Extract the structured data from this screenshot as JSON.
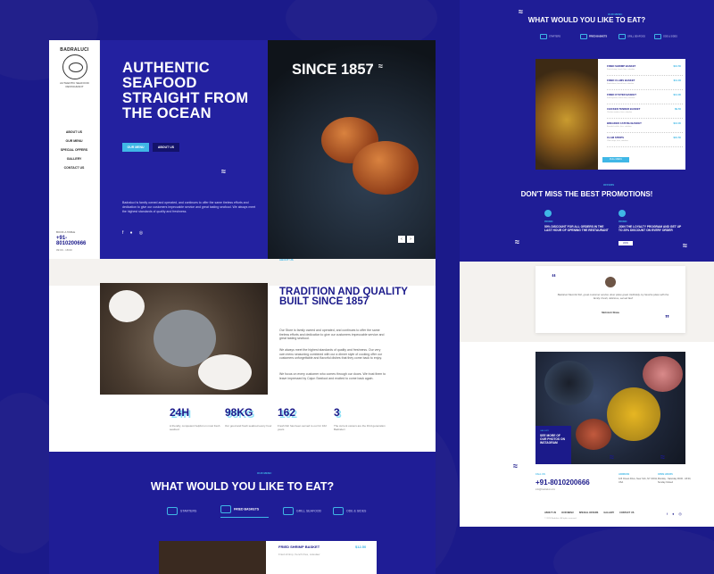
{
  "brand": {
    "name": "BADRALUCI",
    "tagline": "AUTHENTIC SEAFOOD RESTAURANT"
  },
  "nav": [
    "ABOUT US",
    "OUR MENU",
    "SPECIAL OFFERS",
    "GALLERY",
    "CONTACT US"
  ],
  "side_contact": {
    "label": "BOOK A TABLE",
    "phone": "+91-8010200666",
    "hours": "09:00 - 18:00"
  },
  "hero": {
    "title": "AUTHENTIC SEAFOOD STRAIGHT FROM THE OCEAN",
    "btn_primary": "OUR MENU",
    "btn_secondary": "ABOUT US",
    "description": "Badraluci is family owned and operated, and continues to offer the same tireless efforts and dedication to give our customers impeccable service and great tasting seafood. We always meet the highest standards of quality and freshness.",
    "social": "f ♦ ◎",
    "since": "SINCE 1857",
    "arrow_prev": "‹",
    "arrow_next": "›"
  },
  "about": {
    "small": "ABOUT US",
    "title": "TRADITION AND QUALITY BUILT SINCE 1857",
    "p1": "Our Store is family owned and operated, and continues to offer the same tireless efforts and dedication to give our customers impeccable service and great tasting seafood.",
    "p2": "We always meet the highest standards of quality and freshness. Our very own menu seasoning combined with our a dinner style of cooking offer our customers unforgettable and flavorful dishes that they come back to enjoy.",
    "p3": "We focus on every customer who comes through our doors. We trust them to leave impressed by Cajun Seafood and excited to come back again."
  },
  "stats": [
    {
      "num": "24H",
      "txt": "A friendly, competent helpful on most fresh seafood"
    },
    {
      "num": "98KG",
      "txt": "Our good and fresh seafood every hour"
    },
    {
      "num": "162",
      "txt": "Fresh fish has been served to our for 162 years"
    },
    {
      "num": "3",
      "txt": "The current owners are the third generation Badraluci"
    }
  ],
  "menu_left": {
    "small": "OUR MENU",
    "title": "WHAT WOULD YOU LIKE TO EAT?",
    "tabs": [
      "STARTERS",
      "FRIED BASKETS",
      "GRILL SEAFOOD",
      "ODE & SIDES"
    ],
    "item_name": "FRIED SHRIMP BASKET",
    "item_price": "$12.50",
    "item_desc": "Fried shrimp, french fries, coleslaw"
  },
  "right": {
    "small": "OUR MENU",
    "title": "WHAT WOULD YOU LIKE TO EAT?",
    "tabs": [
      "STARTERS",
      "FRIED BASKETS",
      "GRILL SEAFOOD",
      "ODE & SIDES"
    ],
    "items": [
      {
        "n": "FRIED SHRIMP BASKET",
        "p": "$12.50",
        "d": "Fried shrimp, french fries, coleslaw"
      },
      {
        "n": "FRIED CLAMS BASKET",
        "p": "$11.00",
        "d": "Fried clams, french fries, coleslaw"
      },
      {
        "n": "FRIED OYSTER BASKET",
        "p": "$14.00",
        "d": "Fried oysters, french fries, coleslaw"
      },
      {
        "n": "CHICKEN TENDER BASKET",
        "p": "$9.50",
        "d": "Chicken tenders, fries, coleslaw"
      },
      {
        "n": "BREADED CATFISH BASKET",
        "p": "$13.00",
        "d": "Breaded catfish, fries, coleslaw"
      },
      {
        "n": "CLAM STRIPS",
        "p": "$10.50",
        "d": "Clam strips, fries, coleslaw"
      }
    ],
    "card_btn": "FULL MENU",
    "promo_small": "OFFERS",
    "promo_title": "DON'T MISS THE BEST PROMOTIONS!",
    "promos": [
      {
        "lbl": "PROMO",
        "t": "50% DISCOUNT FOR ALL ORDERS IN THE LAST HOUR OF OPENING THE RESTAURANT",
        "b": ""
      },
      {
        "lbl": "PROMO",
        "t": "JOIN THE LOYALTY PROGRAM AND GET UP TO 25% DISCOUNT ON EVERY ORDER",
        "b": "JOIN"
      }
    ],
    "testi_text": "Badraluci flavorful fish, great customer service. Ever place great. Definitely my favorite place with the family. Fresh, delicious, served fast!",
    "testi_name": "Mohnish Shaw",
    "gallery_small": "GALLERY",
    "gallery_title": "SEE MORE OF OUR PHOTOS ON INSTAGRAM",
    "contact_label": "CALL US",
    "contact_phone": "+91-8010200666",
    "contact_email": "info@badraluci.com",
    "addr_label": "ADDRESS",
    "addr": "123 Ocean Drive, New York, NY 10011, USA",
    "hours_label": "OPEN HOURS",
    "hours": "Monday - Saturday 09:00 - 18:00, Sunday Closed",
    "footer_links": [
      "ABOUT US",
      "OUR MENU",
      "SPECIAL OFFERS",
      "GALLERY",
      "CONTACT US"
    ],
    "footer_social": "f ♦ ◎",
    "copyright": "© 2020 Badraluci. All rights reserved."
  },
  "colors": {
    "primary": "#1b1a8a",
    "accent": "#3fb7e6",
    "hero": "#2321a0"
  }
}
